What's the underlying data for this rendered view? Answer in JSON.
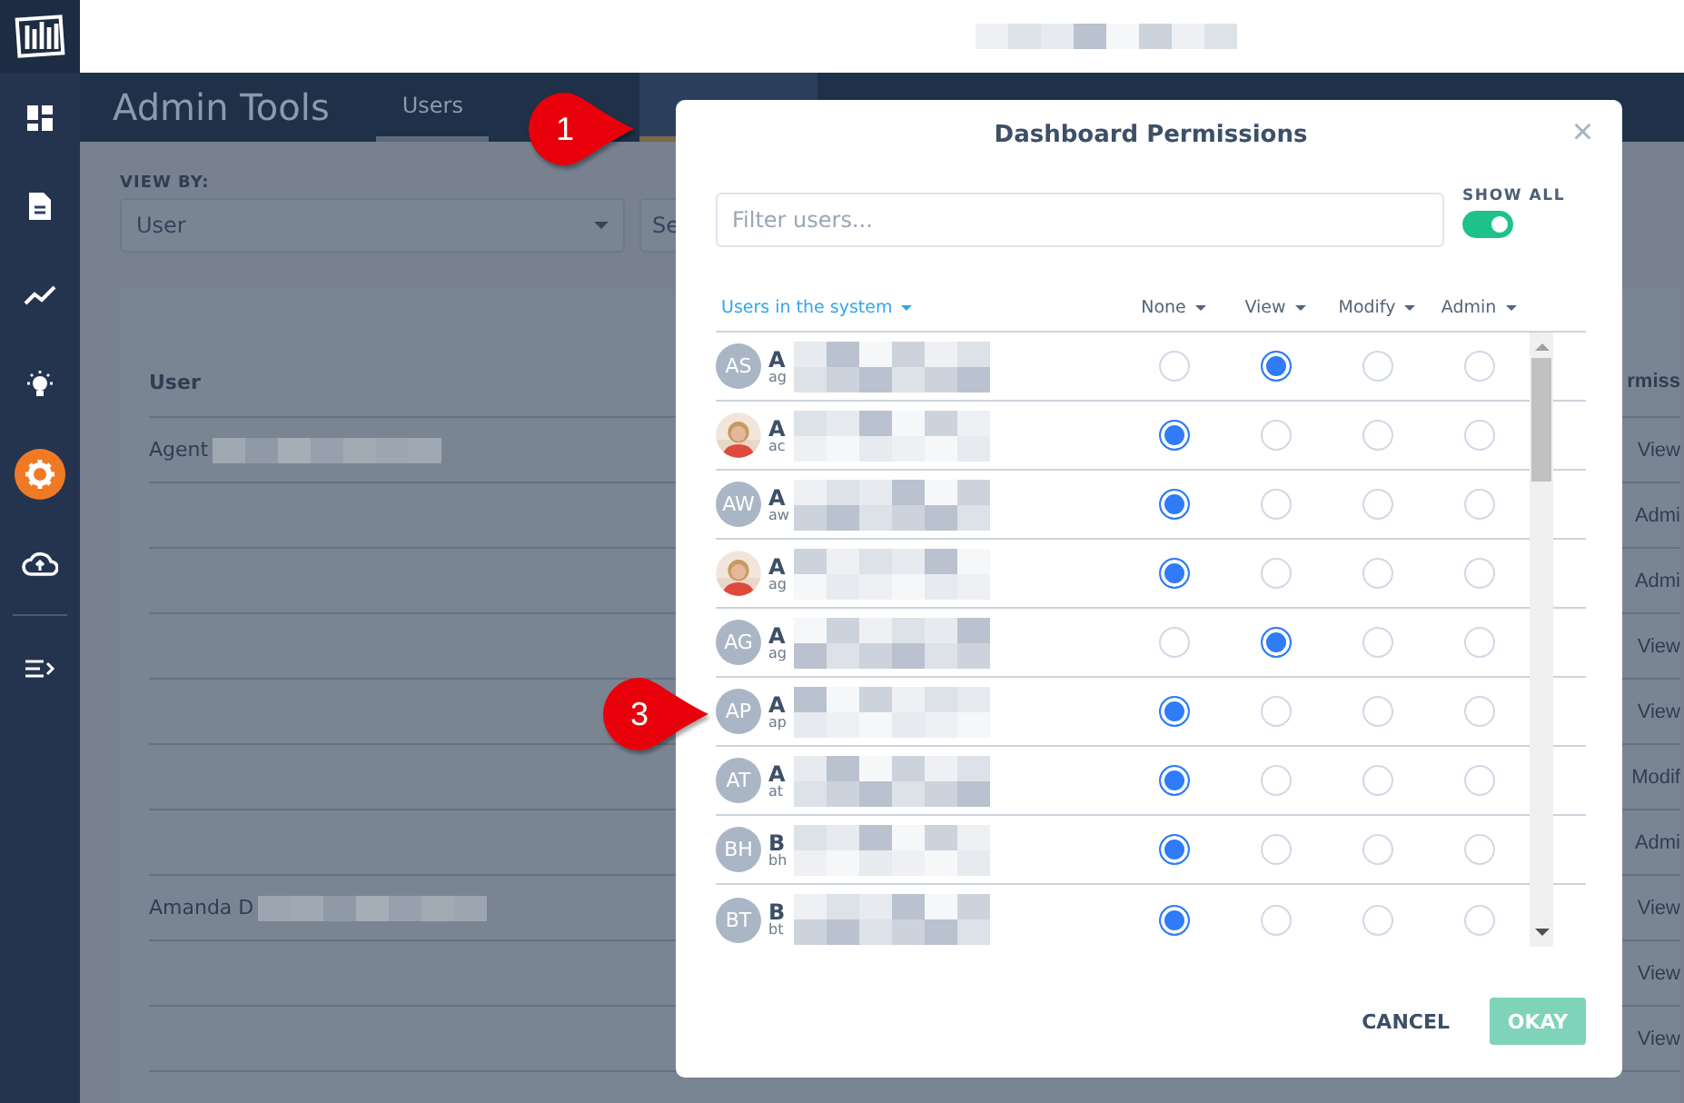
{
  "sidebar": {
    "items": [
      {
        "kind": "dashboard",
        "selected": false
      },
      {
        "kind": "document",
        "selected": false
      },
      {
        "kind": "trend",
        "selected": false
      },
      {
        "kind": "bulb",
        "selected": false
      },
      {
        "kind": "gear",
        "selected": true
      },
      {
        "kind": "upload",
        "selected": false
      },
      {
        "kind": "collapse",
        "selected": false
      }
    ]
  },
  "header": {
    "title": "Admin Tools",
    "tabs": [
      {
        "label": "Users",
        "selected": false
      }
    ]
  },
  "filters": {
    "label": "VIEW BY:",
    "view_by": "User",
    "search_placeholder": "Se"
  },
  "table": {
    "columns": [
      "User",
      "rmiss"
    ],
    "rows": [
      {
        "user": "Agent",
        "permission": "View"
      },
      {
        "permission": "Admi"
      },
      {
        "permission": "Admi"
      },
      {
        "permission": "View"
      },
      {
        "permission": "View"
      },
      {
        "permission": "Modif"
      },
      {
        "permission": "Admi"
      },
      {
        "user": "Amanda D",
        "permission": "View"
      },
      {
        "permission": "View"
      },
      {
        "permission": "View"
      }
    ]
  },
  "dialog": {
    "title": "Dashboard Permissions",
    "close": "×",
    "filter_placeholder": "Filter users...",
    "show_all": {
      "label": "SHOW ALL",
      "on": true
    },
    "users_header": "Users in the system",
    "columns": [
      "None",
      "View",
      "Modify",
      "Admin"
    ],
    "users": [
      {
        "kind": "initials",
        "initials": "AS",
        "name": "A",
        "email": "ag",
        "options": [
          {
            "selected": false
          },
          {
            "selected": true
          },
          {
            "selected": false
          },
          {
            "selected": false
          }
        ]
      },
      {
        "name": "A",
        "email": "ac",
        "options": [
          {
            "selected": true
          },
          {
            "selected": false
          },
          {
            "selected": false
          },
          {
            "selected": false
          }
        ]
      },
      {
        "kind": "initials",
        "initials": "AW",
        "name": "A",
        "email": "aw",
        "options": [
          {
            "selected": true
          },
          {
            "selected": false
          },
          {
            "selected": false
          },
          {
            "selected": false
          }
        ]
      },
      {
        "name": "A",
        "email": "ag",
        "options": [
          {
            "selected": true
          },
          {
            "selected": false
          },
          {
            "selected": false
          },
          {
            "selected": false
          }
        ]
      },
      {
        "kind": "initials",
        "initials": "AG",
        "name": "A",
        "email": "ag",
        "options": [
          {
            "selected": false
          },
          {
            "selected": true
          },
          {
            "selected": false
          },
          {
            "selected": false
          }
        ]
      },
      {
        "kind": "initials",
        "initials": "AP",
        "name": "A",
        "email": "ap",
        "options": [
          {
            "selected": true
          },
          {
            "selected": false
          },
          {
            "selected": false
          },
          {
            "selected": false
          }
        ]
      },
      {
        "kind": "initials",
        "initials": "AT",
        "name": "A",
        "email": "at",
        "options": [
          {
            "selected": true
          },
          {
            "selected": false
          },
          {
            "selected": false
          },
          {
            "selected": false
          }
        ]
      },
      {
        "kind": "initials",
        "initials": "BH",
        "name": "B",
        "email": "bh",
        "options": [
          {
            "selected": true
          },
          {
            "selected": false
          },
          {
            "selected": false
          },
          {
            "selected": false
          }
        ]
      },
      {
        "kind": "initials",
        "initials": "BT",
        "name": "B",
        "email": "bt",
        "options": [
          {
            "selected": true
          },
          {
            "selected": false
          },
          {
            "selected": false
          },
          {
            "selected": false
          }
        ]
      }
    ],
    "buttons": [
      {
        "kind": "cancel",
        "label": "CANCEL",
        "disabled": false
      },
      {
        "kind": "okay",
        "label": "OKAY",
        "disabled": true
      }
    ]
  },
  "callouts": [
    {
      "number": "1"
    },
    {
      "number": "3"
    }
  ]
}
